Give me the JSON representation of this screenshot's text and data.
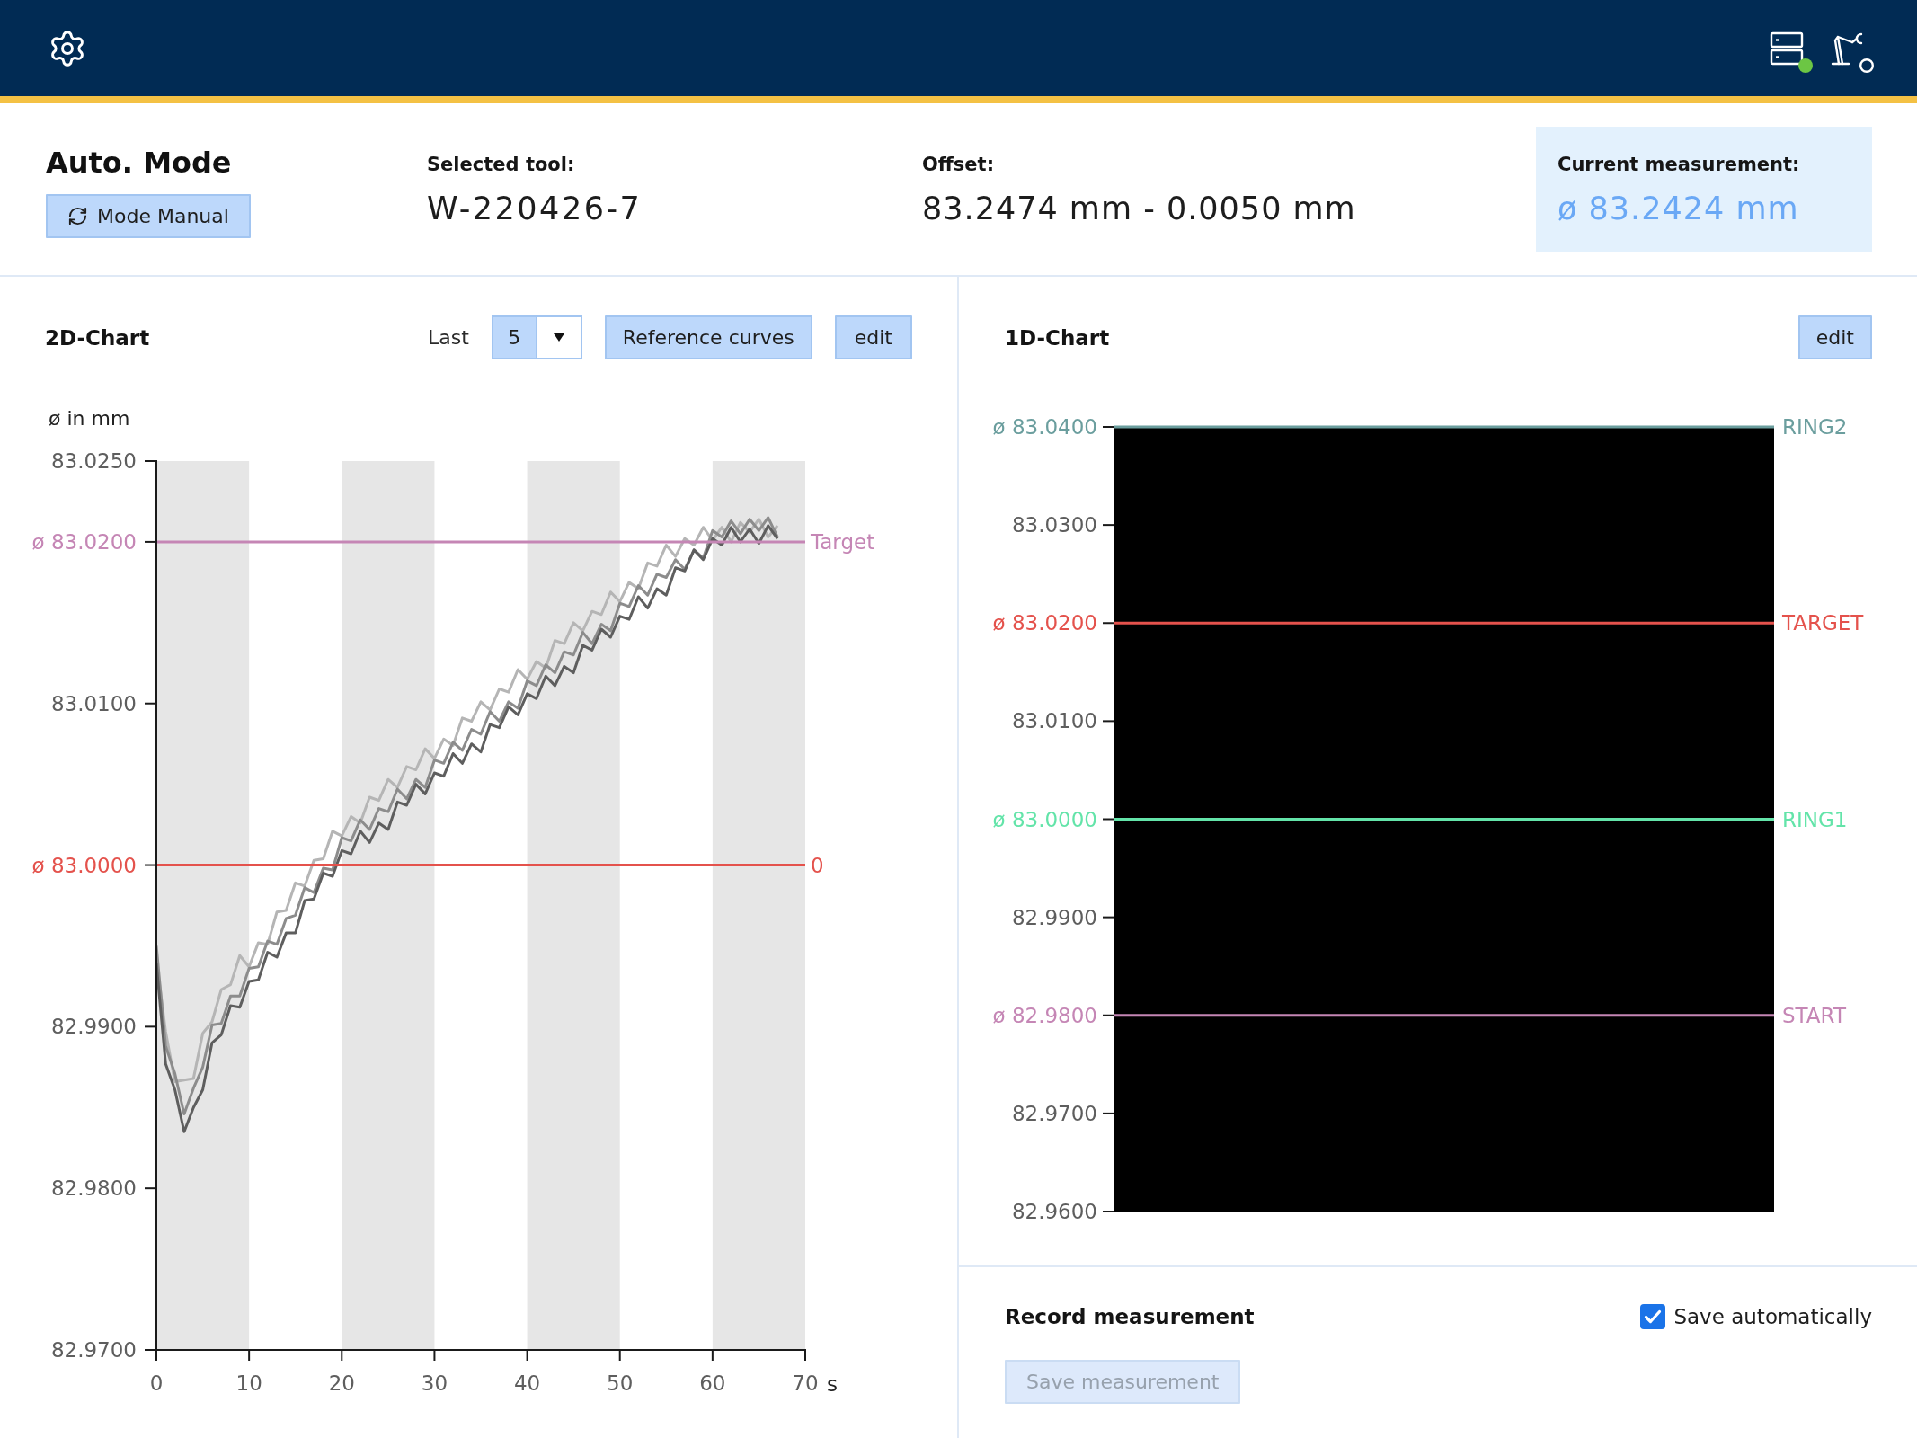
{
  "top_bar": {
    "status_icons": [
      {
        "kind": "server",
        "connected": true
      },
      {
        "kind": "robot",
        "connected": false
      }
    ]
  },
  "header": {
    "mode": {
      "title": "Auto. Mode",
      "button": "Mode Manual"
    },
    "selected_tool": {
      "label": "Selected tool:",
      "value": "W-220426-7"
    },
    "offset": {
      "label": "Offset:",
      "value": "83.2474 mm - 0.0050 mm"
    },
    "current_measurement": {
      "label": "Current measurement:",
      "value": "ø 83.2424 mm"
    }
  },
  "chart_2d": {
    "title": "2D-Chart",
    "count_select": {
      "label": "Last",
      "value": "5"
    },
    "buttons": [
      "Reference curves",
      "edit"
    ],
    "chart_data": {
      "type": "line",
      "xlabel": "s",
      "ylabel": "ø in mm",
      "x": [
        0,
        1,
        2,
        3,
        4,
        5,
        6,
        7,
        8,
        9,
        10,
        11,
        12,
        13,
        14,
        15,
        16,
        17,
        18,
        19,
        20,
        21,
        22,
        23,
        24,
        25,
        26,
        27,
        28,
        29,
        30,
        31,
        32,
        33,
        34,
        35,
        36,
        37,
        38,
        39,
        40,
        41,
        42,
        43,
        44,
        45,
        46,
        47,
        48,
        49,
        50,
        51,
        52,
        53,
        54,
        55,
        56,
        57,
        58,
        59,
        60,
        61,
        62,
        63,
        64,
        65,
        66,
        67
      ],
      "series": [
        {
          "color": "#b5b5b5",
          "values": [
            82.9942,
            82.9897,
            82.9866,
            82.9867,
            82.9868,
            82.9896,
            82.9903,
            82.9923,
            82.9926,
            82.9944,
            82.9937,
            82.9952,
            82.9951,
            82.9971,
            82.9972,
            82.9989,
            82.9987,
            83.0003,
            83.0004,
            83.0021,
            83.0018,
            83.003,
            83.0026,
            83.0042,
            83.004,
            83.0053,
            83.0048,
            83.0061,
            83.0059,
            83.0072,
            83.0066,
            83.0078,
            83.0074,
            83.0091,
            83.0089,
            83.0101,
            83.0096,
            83.0109,
            83.0107,
            83.0121,
            83.0115,
            83.0126,
            83.0122,
            83.0139,
            83.0137,
            83.015,
            83.0145,
            83.0157,
            83.0155,
            83.0169,
            83.0163,
            83.0175,
            83.0171,
            83.0187,
            83.0185,
            83.0198,
            83.0191,
            83.0202,
            83.0198,
            83.0209,
            83.0201,
            83.0209,
            83.02,
            83.0212,
            83.0206,
            83.0214,
            83.0203,
            83.021
          ]
        },
        {
          "color": "#8c8c8c",
          "values": [
            82.995,
            82.9888,
            82.9871,
            82.9846,
            82.9862,
            82.9875,
            82.9901,
            82.9902,
            82.9919,
            82.9919,
            82.9936,
            82.9937,
            82.9953,
            82.9951,
            82.9967,
            82.9969,
            82.9986,
            82.9983,
            82.9998,
            82.9997,
            83.0017,
            83.0015,
            83.0028,
            83.0022,
            83.0035,
            83.0033,
            83.0047,
            83.0041,
            83.0053,
            83.0048,
            83.0065,
            83.0063,
            83.0076,
            83.0071,
            83.0084,
            83.0081,
            83.0095,
            83.0089,
            83.0101,
            83.0097,
            83.0114,
            83.0111,
            83.0124,
            83.0119,
            83.0132,
            83.013,
            83.0144,
            83.0137,
            83.0149,
            83.0145,
            83.0162,
            83.016,
            83.0173,
            83.0167,
            83.018,
            83.0178,
            83.0189,
            83.0183,
            83.0195,
            83.019,
            83.0207,
            83.0203,
            83.0213,
            83.0205,
            83.0214,
            83.0207,
            83.0215,
            83.0203
          ]
        },
        {
          "color": "#5e5e5e",
          "values": [
            82.9939,
            82.9877,
            82.9861,
            82.9835,
            82.985,
            82.9861,
            82.989,
            82.9895,
            82.9913,
            82.9912,
            82.9928,
            82.9929,
            82.9946,
            82.9943,
            82.9958,
            82.9958,
            82.9978,
            82.9979,
            82.9995,
            82.9993,
            83.0009,
            83.0007,
            83.0021,
            83.0014,
            83.0026,
            83.0022,
            83.0039,
            83.0037,
            83.005,
            83.0044,
            83.0057,
            83.0055,
            83.0069,
            83.0063,
            83.0075,
            83.007,
            83.0087,
            83.0085,
            83.0098,
            83.0093,
            83.0106,
            83.0103,
            83.0117,
            83.0111,
            83.0123,
            83.0119,
            83.0136,
            83.0133,
            83.0146,
            83.0141,
            83.0154,
            83.0152,
            83.0166,
            83.0159,
            83.0171,
            83.0167,
            83.0184,
            83.0182,
            83.0195,
            83.0189,
            83.0202,
            83.0198,
            83.0209,
            83.02,
            83.0208,
            83.0199,
            83.021,
            83.0202
          ]
        }
      ],
      "xlim": [
        0,
        70
      ],
      "ylim": [
        82.97,
        83.025
      ],
      "xticks": [
        0,
        10,
        20,
        30,
        40,
        50,
        60,
        70
      ],
      "yticks": [
        {
          "value": 83.025,
          "label": "83.0250"
        },
        {
          "value": 83.02,
          "label": "ø 83.0200"
        },
        {
          "value": 83.01,
          "label": "83.0100"
        },
        {
          "value": 83.0,
          "label": "ø 83.0000"
        },
        {
          "value": 82.99,
          "label": "82.9900"
        },
        {
          "value": 82.98,
          "label": "82.9800"
        },
        {
          "value": 82.97,
          "label": "82.9700"
        }
      ],
      "ref_lines": [
        {
          "axis": "y",
          "value": 83.02,
          "label": "Target",
          "color": "#c586b5"
        },
        {
          "axis": "y",
          "value": 83.0,
          "color": "#e4524c"
        }
      ],
      "annotations": [
        {
          "x": 70,
          "y": 83.0,
          "text": "0"
        }
      ]
    }
  },
  "chart_1d": {
    "title": "1D-Chart",
    "buttons": [
      "edit"
    ],
    "chart_data": {
      "type": "line",
      "categories": [
        null
      ],
      "ylim": [
        82.96,
        83.04
      ],
      "yticks": [
        {
          "value": 83.04,
          "label": "ø 83.0400"
        },
        {
          "value": 83.03,
          "label": "83.0300"
        },
        {
          "value": 83.02,
          "label": "ø 83.0200"
        },
        {
          "value": 83.01,
          "label": "83.0100"
        },
        {
          "value": 83.0,
          "label": "ø 83.0000"
        },
        {
          "value": 82.99,
          "label": "82.9900"
        },
        {
          "value": 82.98,
          "label": "ø 82.9800"
        },
        {
          "value": 82.97,
          "label": "82.9700"
        },
        {
          "value": 82.96,
          "label": "82.9600"
        }
      ],
      "ref_lines": [
        {
          "axis": "y",
          "value": 83.04,
          "label": "RING2",
          "color": "#6b9e9e"
        },
        {
          "axis": "y",
          "value": 83.02,
          "label": "TARGET",
          "color": "#e4524c"
        },
        {
          "axis": "y",
          "value": 83.0,
          "label": "RING1",
          "color": "#63e4a9"
        },
        {
          "axis": "y",
          "value": 82.98,
          "label": "START",
          "color": "#c586b5"
        }
      ]
    }
  },
  "record": {
    "title": "Record measurement",
    "save_automatically": {
      "label": "Save automatically",
      "checked": true
    },
    "save_button": {
      "label": "Save measurement",
      "disabled": true
    }
  }
}
